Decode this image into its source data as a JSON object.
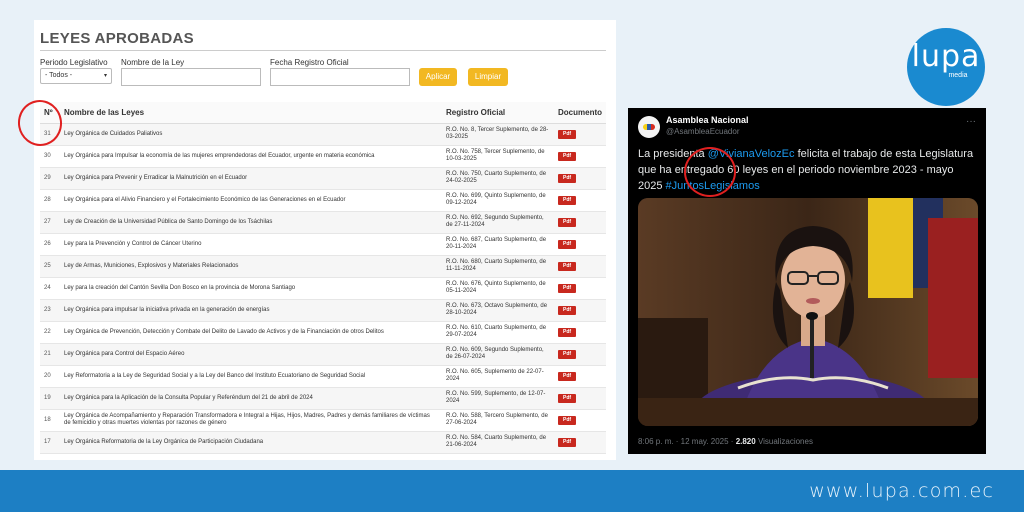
{
  "left": {
    "title": "LEYES APROBADAS",
    "filters": {
      "period_label": "Periodo Legislativo",
      "period_value": "- Todos -",
      "name_label": "Nombre de la Ley",
      "date_label": "Fecha Registro Oficial",
      "apply": "Aplicar",
      "clear": "Limpiar"
    },
    "headers": [
      "Nº",
      "Nombre de las Leyes",
      "Registro Oficial",
      "Documento"
    ],
    "pdf": "Pdf",
    "rows": [
      {
        "n": "31",
        "name": "Ley Orgánica de Cuidados Paliativos",
        "ro": "R.O. No. 8, Tercer Suplemento, de 28-03-2025"
      },
      {
        "n": "30",
        "name": "Ley Orgánica para Impulsar la economía de las mujeres emprendedoras del Ecuador, urgente en materia económica",
        "ro": "R.O. No. 758, Tercer Suplemento, de 10-03-2025"
      },
      {
        "n": "29",
        "name": "Ley Orgánica para Prevenir y Erradicar la Malnutrición en el Ecuador",
        "ro": "R.O. No. 750, Cuarto Suplemento, de 24-02-2025"
      },
      {
        "n": "28",
        "name": "Ley Orgánica para el Alivio Financiero y el Fortalecimiento Económico de las Generaciones en el Ecuador",
        "ro": "R.O. No. 699, Quinto Suplemento, de 09-12-2024"
      },
      {
        "n": "27",
        "name": "Ley de Creación de la Universidad Pública de Santo Domingo de los Tsáchilas",
        "ro": "R.O. No. 692, Segundo Suplemento, de 27-11-2024"
      },
      {
        "n": "26",
        "name": "Ley para la Prevención y Control de Cáncer Uterino",
        "ro": "R.O. No. 687, Cuarto Suplemento, de 20-11-2024"
      },
      {
        "n": "25",
        "name": "Ley de Armas, Municiones, Explosivos y Materiales Relacionados",
        "ro": "R.O. No. 680, Cuarto Suplemento, de 11-11-2024"
      },
      {
        "n": "24",
        "name": "Ley para la creación del Cantón Sevilla Don Bosco en la provincia de Morona Santiago",
        "ro": "R.O. No. 676, Quinto Suplemento, de 05-11-2024"
      },
      {
        "n": "23",
        "name": "Ley Orgánica para impulsar la iniciativa privada en la generación de energías",
        "ro": "R.O. No. 673, Octavo Suplemento, de 28-10-2024"
      },
      {
        "n": "22",
        "name": "Ley Orgánica de Prevención, Detección y Combate del Delito de Lavado de Activos y de la Financiación de otros Delitos",
        "ro": "R.O. No. 610, Cuarto Suplemento, de 29-07-2024"
      },
      {
        "n": "21",
        "name": "Ley Orgánica para Control del Espacio Aéreo",
        "ro": "R.O. No. 609, Segundo Suplemento, de 26-07-2024"
      },
      {
        "n": "20",
        "name": "Ley Reformatoria a la Ley de Seguridad Social y a la Ley del Banco del Instituto Ecuatoriano de Seguridad Social",
        "ro": "R.O. No. 605, Suplemento de 22-07-2024"
      },
      {
        "n": "19",
        "name": "Ley Orgánica para la Aplicación de la Consulta Popular y Referéndum del 21 de abril de 2024",
        "ro": "R.O. No. 599, Suplemento, de 12-07-2024"
      },
      {
        "n": "18",
        "name": "Ley Orgánica de Acompañamiento y Reparación Transformadora e Integral a Hijas, Hijos, Madres, Padres y demás familiares de víctimas de femicidio y otras muertes violentas por razones de género",
        "ro": "R.O. No. 588, Tercero Suplemento, de 27-06-2024"
      },
      {
        "n": "17",
        "name": "Ley Orgánica Reformatoria de la Ley Orgánica de Participación Ciudadana",
        "ro": "R.O. No. 584, Cuarto Suplemento, de 21-06-2024"
      }
    ]
  },
  "tweet": {
    "name": "Asamblea Nacional",
    "handle": "@AsambleaEcuador",
    "more": "···",
    "text_1": "La presidenta ",
    "mention": "@VivianaVelozEc",
    "text_2": " felicita el trabajo de esta Legislatura que ha entregado 60 leyes en el periodo noviembre 2023 - mayo 2025 ",
    "hashtag": "#JuntosLegislamos",
    "time": "8:06 p. m. · 12 may. 2025 · ",
    "views_count": "2.820",
    "views_label": " Visualizaciones"
  },
  "logo": {
    "word": "lupa",
    "sub": "media"
  },
  "footer": {
    "url": "www.lupa.com.ec"
  },
  "colors": {
    "band": "#1d7fc4",
    "pdf": "#c8281e",
    "button": "#f2b822",
    "link": "#1d9bf0",
    "annotation": "#e02020"
  }
}
